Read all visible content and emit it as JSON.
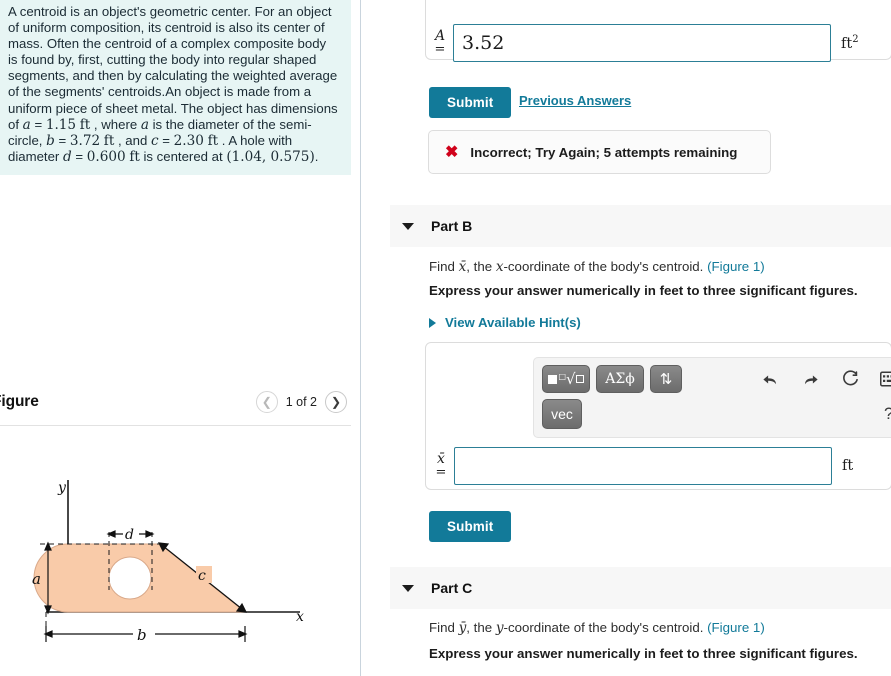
{
  "left": {
    "intro": {
      "segments": [
        {
          "t": "A centroid is an object's geometric center. For an object of uniform composition, its centroid is also its center of mass. Often the centroid of a complex composite body is found by, first, cutting the body into regular shaped segments, and then by calculating the weighted average of the segments' centroids.An object is made from a uniform piece of sheet metal. The object has dimensions of "
        },
        {
          "t": "a",
          "style": "var"
        },
        {
          "t": " = "
        },
        {
          "t": "1.15",
          "style": "num"
        },
        {
          "t": " ",
          "style": "plain"
        },
        {
          "t": "ft",
          "style": "unit"
        },
        {
          "t": " , where "
        },
        {
          "t": "a",
          "style": "var"
        },
        {
          "t": " is the diameter of the semi-circle, "
        },
        {
          "t": "b",
          "style": "var"
        },
        {
          "t": " = "
        },
        {
          "t": "3.72",
          "style": "num"
        },
        {
          "t": " ",
          "style": "plain"
        },
        {
          "t": "ft",
          "style": "unit"
        },
        {
          "t": " , and "
        },
        {
          "t": "c",
          "style": "var"
        },
        {
          "t": " = "
        },
        {
          "t": "2.30",
          "style": "num"
        },
        {
          "t": " ",
          "style": "plain"
        },
        {
          "t": "ft",
          "style": "unit"
        },
        {
          "t": " . A hole with diameter "
        },
        {
          "t": "d",
          "style": "var"
        },
        {
          "t": " = "
        },
        {
          "t": "0.600",
          "style": "num"
        },
        {
          "t": " ",
          "style": "plain"
        },
        {
          "t": "ft",
          "style": "unit"
        },
        {
          "t": " is centered at "
        },
        {
          "t": "(1.04, 0.575)",
          "style": "num"
        },
        {
          "t": "."
        }
      ]
    },
    "figure": {
      "title": "Figure",
      "prev_icon": "chevron-left-icon",
      "next_icon": "chevron-right-icon",
      "counter": "1 of 2",
      "labels": {
        "y_axis": "y",
        "x_axis": "x",
        "a": "a",
        "b": "b",
        "c": "c",
        "d": "d"
      },
      "shape_fill": "#f9cba9"
    }
  },
  "right": {
    "partA": {
      "answer_var": "A",
      "equals": "=",
      "value": "3.52",
      "placeholder": "",
      "unit": "ft",
      "unit_sup": "2",
      "submit_label": "Submit",
      "previous_answers_label": "Previous Answers",
      "feedback_icon": "x-mark-icon",
      "feedback_text": "Incorrect; Try Again; 5 attempts remaining"
    },
    "partB": {
      "title": "Part B",
      "caret_icon": "caret-down-icon",
      "question_pre": "Find ",
      "question_var": "x̄",
      "question_mid": ", the ",
      "question_var2": "x",
      "question_post": "-coordinate of the body's centroid. ",
      "figure_link": "(Figure 1)",
      "instruction": "Express your answer numerically in feet to three significant figures.",
      "hint_label": "View Available Hint(s)",
      "palette": {
        "btn_sqrt": "template-sqrt-button",
        "btn_greek": "ΑΣϕ",
        "btn_updown": "⇅",
        "btn_vec": "vec",
        "undo_icon": "undo-icon",
        "redo_icon": "redo-icon",
        "reset_icon": "reset-icon",
        "keyboard_icon": "keyboard-icon",
        "help_label": "?"
      },
      "answer_var": "x̄",
      "equals": "=",
      "value": "",
      "unit": "ft",
      "submit_label": "Submit"
    },
    "partC": {
      "title": "Part C",
      "caret_icon": "caret-down-icon",
      "question_pre": "Find ",
      "question_var": "ȳ",
      "question_mid": ", the ",
      "question_var2": "y",
      "question_post": "-coordinate of the body's centroid. ",
      "figure_link": "(Figure 1)",
      "instruction": "Express your answer numerically in feet to three significant figures."
    }
  },
  "colors": {
    "accent": "#127a99",
    "error": "#d0021b",
    "intro_bg": "#e7f5f4",
    "part_header_bg": "#f7f7f7",
    "shape": "#f9cba9"
  }
}
